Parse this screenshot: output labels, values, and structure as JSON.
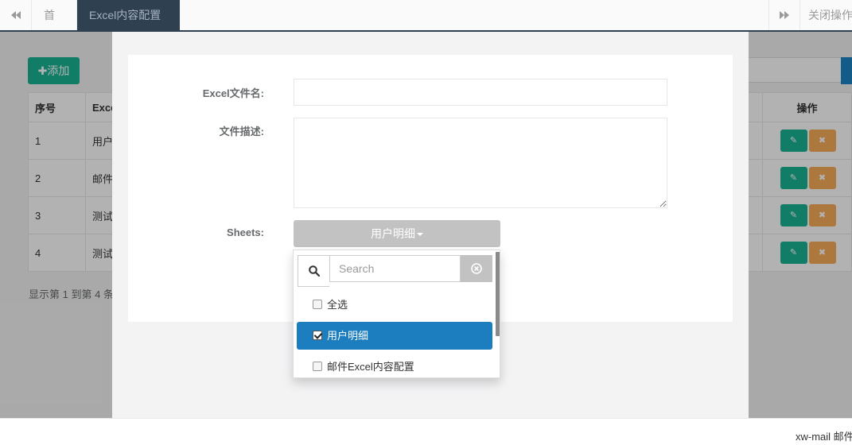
{
  "tabbar": {
    "home_label": "首页",
    "active_tab_label": "Excel内容配置",
    "close_ops_label": "关闭操作"
  },
  "background": {
    "add_button_label": "✚添加",
    "table": {
      "headers": [
        "序号",
        "Exce",
        "操作"
      ],
      "rows": [
        {
          "no": "1",
          "name": "用户"
        },
        {
          "no": "2",
          "name": "邮件"
        },
        {
          "no": "3",
          "name": "测试"
        },
        {
          "no": "4",
          "name": "测试"
        }
      ]
    },
    "footer_text": "显示第 1 到第 4 条"
  },
  "modal": {
    "excel_name_label": "Excel文件名:",
    "excel_name_value": "",
    "description_label": "文件描述:",
    "description_value": "",
    "sheets_label": "Sheets:",
    "sheets_selected": "用户明细"
  },
  "dropdown": {
    "search_placeholder": "Search",
    "items": [
      {
        "label": "全选",
        "checked": false
      },
      {
        "label": "用户明细",
        "checked": true
      },
      {
        "label": "邮件Excel内容配置",
        "checked": false
      }
    ]
  },
  "statusbar": {
    "text": "xw-mail 邮件"
  },
  "colors": {
    "primary": "#1ab394",
    "warning": "#f8ac59",
    "nav_dark": "#2f4050",
    "selected_item": "#1c7dbf"
  }
}
